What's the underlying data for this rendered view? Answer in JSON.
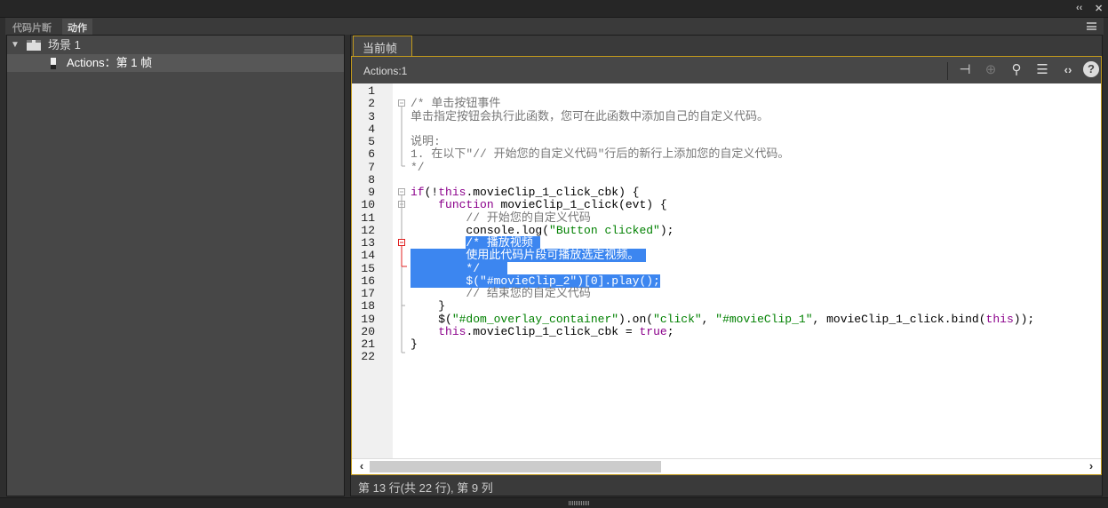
{
  "window": {
    "collapse_label": "‹‹",
    "close_label": "✕"
  },
  "tabs": [
    {
      "label": "代码片断"
    },
    {
      "label": "动作"
    }
  ],
  "tree": {
    "scene": "场景 1",
    "frame": "Actions：第 1 帧"
  },
  "editor_tab": "当前帧",
  "toolbar": {
    "label": "Actions:1",
    "icons": [
      "pin-icon",
      "target-icon",
      "search-icon",
      "format-icon",
      "code-icon",
      "help-icon"
    ]
  },
  "code_lines": [
    [],
    [
      [
        "/* 单击按钮事件",
        "cm"
      ]
    ],
    [
      [
        "单击指定按钮会执行此函数，您可在此函数中添加自己的自定义代码。",
        "cm"
      ]
    ],
    [],
    [
      [
        "说明:",
        "cm"
      ]
    ],
    [
      [
        "1. 在以下\"// 开始您的自定义代码\"行后的新行上添加您的自定义代码。",
        "cm"
      ]
    ],
    [
      [
        "*/",
        "cm"
      ]
    ],
    [],
    [
      [
        "if",
        "kw"
      ],
      [
        "(!",
        ""
      ],
      [
        "this",
        "kw"
      ],
      [
        ".movieClip_1_click_cbk) {",
        ""
      ]
    ],
    [
      [
        "    ",
        ""
      ],
      [
        "function",
        "kw"
      ],
      [
        " movieClip_1_click(evt) {",
        ""
      ]
    ],
    [
      [
        "        ",
        ""
      ],
      [
        "// 开始您的自定义代码",
        "cm"
      ]
    ],
    [
      [
        "        console.log(",
        ""
      ],
      [
        "\"Button clicked\"",
        "str"
      ],
      [
        ");",
        ""
      ]
    ],
    [
      [
        "        ",
        ""
      ],
      [
        "/* 播放视频 ",
        "sel"
      ]
    ],
    [
      [
        "        使用此代码片段可播放选定视频。 ",
        "sel"
      ]
    ],
    [
      [
        "        */    ",
        "sel"
      ]
    ],
    [
      [
        "        $(\"#movieClip_2\")[0].play();",
        "sel"
      ]
    ],
    [
      [
        "        ",
        ""
      ],
      [
        "// 结束您的自定义代码",
        "cm"
      ]
    ],
    [
      [
        "    }",
        ""
      ]
    ],
    [
      [
        "    $(",
        ""
      ],
      [
        "\"#dom_overlay_container\"",
        "str"
      ],
      [
        ").on(",
        ""
      ],
      [
        "\"click\"",
        "str"
      ],
      [
        ", ",
        ""
      ],
      [
        "\"#movieClip_1\"",
        "str"
      ],
      [
        ", movieClip_1_click.bind(",
        ""
      ],
      [
        "this",
        "kw"
      ],
      [
        "));",
        ""
      ]
    ],
    [
      [
        "    ",
        ""
      ],
      [
        "this",
        "kw"
      ],
      [
        ".movieClip_1_click_cbk = ",
        ""
      ],
      [
        "true",
        "kw"
      ],
      [
        ";",
        ""
      ]
    ],
    [
      [
        "}",
        ""
      ]
    ],
    []
  ],
  "status": "第 13 行(共 22 行), 第  9 列",
  "colors": {
    "accent": "#c39a1c",
    "selection": "#3c86f0"
  }
}
